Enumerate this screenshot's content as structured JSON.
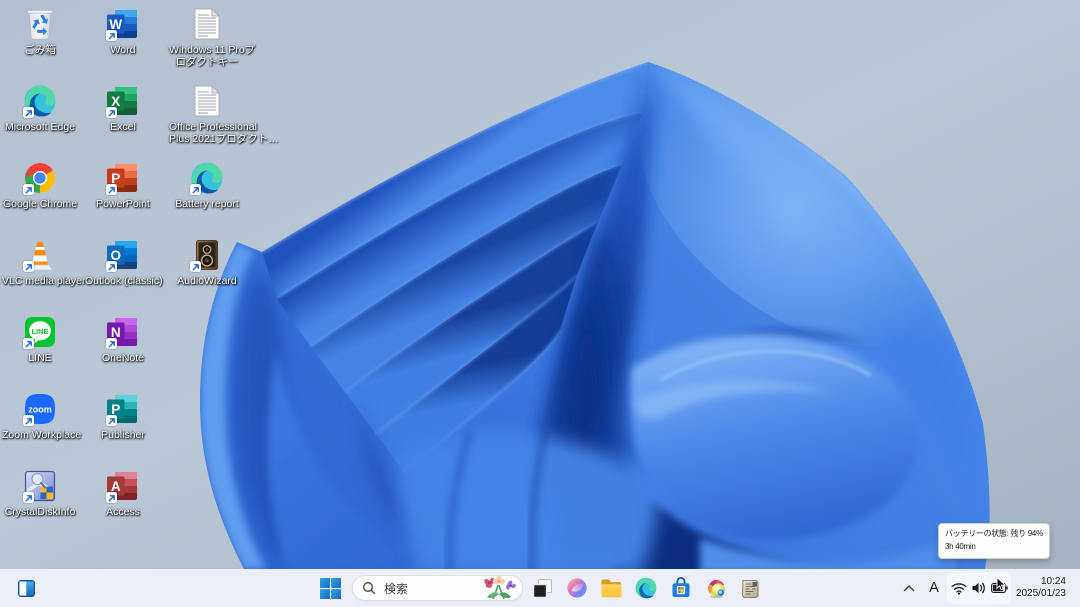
{
  "desktop": {
    "icons": [
      {
        "icon": "recycle-bin-icon",
        "label": "ごみ箱",
        "shortcut": false
      },
      {
        "icon": "edge-icon",
        "label": "Microsoft Edge",
        "shortcut": true
      },
      {
        "icon": "chrome-icon",
        "label": "Google Chrome",
        "shortcut": true
      },
      {
        "icon": "vlc-icon",
        "label": "VLC media player",
        "shortcut": true
      },
      {
        "icon": "line-icon",
        "label": "LINE",
        "shortcut": true
      },
      {
        "icon": "zoom-icon",
        "label": "Zoom Workplace",
        "shortcut": true
      },
      {
        "icon": "crystaldiskinfo-icon",
        "label": "CrystalDiskInfo",
        "shortcut": true
      },
      {
        "icon": "word-icon",
        "label": "Word",
        "shortcut": true
      },
      {
        "icon": "excel-icon",
        "label": "Excel",
        "shortcut": true
      },
      {
        "icon": "powerpoint-icon",
        "label": "PowerPoint",
        "shortcut": true
      },
      {
        "icon": "outlook-icon",
        "label": "Outlook (classic)",
        "shortcut": true
      },
      {
        "icon": "onenote-icon",
        "label": "OneNote",
        "shortcut": true
      },
      {
        "icon": "publisher-icon",
        "label": "Publisher",
        "shortcut": true
      },
      {
        "icon": "access-icon",
        "label": "Access",
        "shortcut": true
      },
      {
        "icon": "text-file-icon",
        "label": "Windows 11 Proプ\nロダクトキー",
        "shortcut": false
      },
      {
        "icon": "text-file-icon",
        "label": "Office Professional\nPlus 2021プロダクト…",
        "shortcut": false
      },
      {
        "icon": "edge-icon",
        "label": "Battery report",
        "shortcut": true
      },
      {
        "icon": "audiowizard-icon",
        "label": "AudioWizard",
        "shortcut": true
      }
    ]
  },
  "taskbar": {
    "widgets_icon": "widgets-icon",
    "start_icon": "start-icon",
    "search": {
      "placeholder": "検索",
      "decoration": "flowers-illustration"
    },
    "buttons": [
      {
        "icon": "task-view-icon"
      },
      {
        "icon": "copilot-icon"
      },
      {
        "icon": "file-explorer-icon"
      },
      {
        "icon": "edge-icon"
      },
      {
        "icon": "microsoft-store-icon"
      },
      {
        "icon": "color-wheel-app-icon"
      },
      {
        "icon": "paper-app-icon"
      }
    ],
    "tray": {
      "chevron_icon": "chevron-up-icon",
      "ime_label": "A",
      "wifi_icon": "wifi-icon",
      "volume_icon": "volume-icon",
      "battery_icon": "battery-icon",
      "time": "10:24",
      "date": "2025/01/23"
    }
  },
  "tooltip": {
    "line1": "バッテリーの状態: 残り 94%",
    "line2": "3h 40min"
  },
  "colors": {
    "taskbar_background": "#eceff7",
    "bloom_blue": "#3a74de",
    "background_sky": "#b3c0d1",
    "selection_blue": "#0078d4"
  }
}
